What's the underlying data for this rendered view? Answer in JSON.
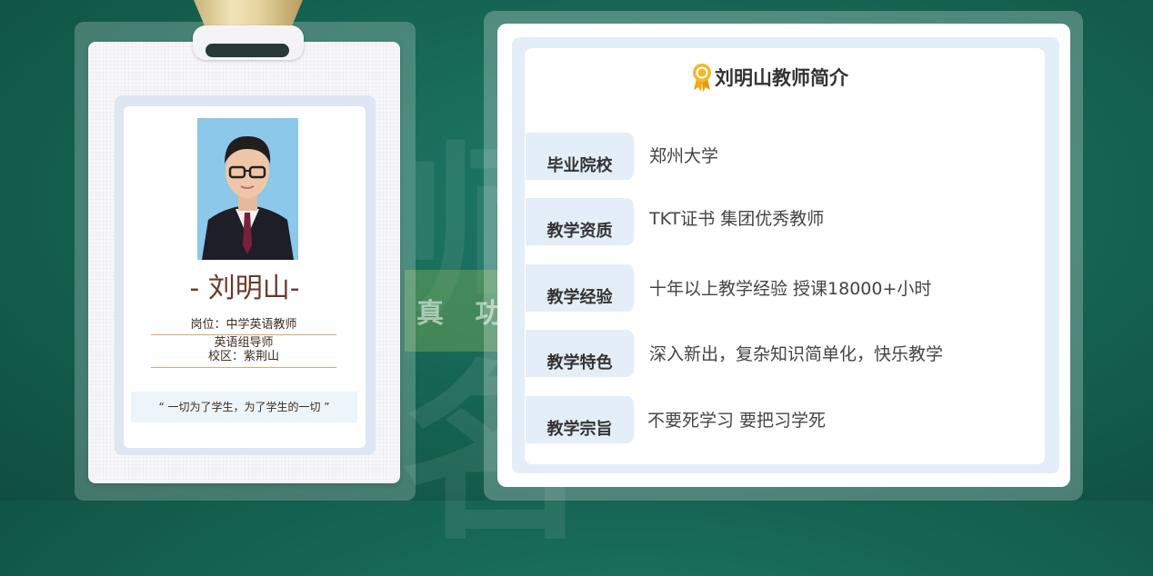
{
  "badge": {
    "name": "- 刘明山-",
    "position_line": "岗位：中学英语教师",
    "role_line": "英语组导师",
    "campus_line": "校区：紫荆山",
    "motto": "“ 一切为了学生，为了学生的一切 ”",
    "photo_icon": "teacher-portrait"
  },
  "profile": {
    "title": "刘明山教师简介",
    "title_icon": "medal-icon",
    "rows": [
      {
        "label": "毕业院校",
        "value": "郑州大学"
      },
      {
        "label": "教学资质",
        "value": "TKT证书 集团优秀教师"
      },
      {
        "label": "教学经验",
        "value": "十年以上教学经验 授课18000+小时"
      },
      {
        "label": "教学特色",
        "value": "深入新出，复杂知识简单化，快乐教学"
      },
      {
        "label": "教学宗旨",
        "value": "不要死学习 要把习学死"
      }
    ]
  },
  "background": {
    "banner_text": "真 功"
  },
  "colors": {
    "background": "#156251",
    "name_color": "#6b3a2a",
    "label_bg": "#e3eef8",
    "rule": "#d6a870",
    "medal": "#f0a818"
  }
}
